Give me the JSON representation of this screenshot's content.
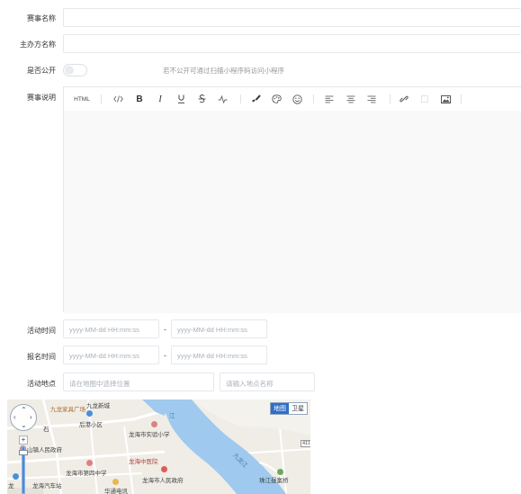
{
  "form": {
    "event_name_label": "赛事名称",
    "organizer_label": "主办方名称",
    "public_label": "是否公开",
    "public_hint": "若不公开可通过扫描小程序码访问小程序",
    "public_on": false,
    "description_label": "赛事说明",
    "activity_time_label": "活动时间",
    "signup_time_label": "报名时间",
    "location_label": "活动地点",
    "datetime_placeholder": "yyyy-MM-dd HH:mm:ss",
    "range_separator": "-",
    "map_select_placeholder": "请在地图中选择位置",
    "place_name_placeholder": "请输入地点名称"
  },
  "toolbar": {
    "html_label": "HTML",
    "icons": [
      "code-icon",
      "bold-icon",
      "italic-icon",
      "underline-icon",
      "strikethrough-icon",
      "wave-icon",
      "brush-icon",
      "palette-icon",
      "emoji-icon",
      "align-left-icon",
      "align-center-icon",
      "align-right-icon",
      "link-icon",
      "unlink-icon",
      "image-icon"
    ]
  },
  "map": {
    "type_map": "地图",
    "type_satellite": "卫星",
    "labels": {
      "l1": "九龙家具广场",
      "l2": "九龙新城",
      "l3": "后港小区",
      "l4": "龙海市实验小学",
      "l5": "山镇人民政府",
      "l6": "龙海中医院",
      "l7": "龙海市第四中学",
      "l8": "龙海市人民政府",
      "l9": "华通电讯",
      "l10": "九龙江",
      "l11": "珠江昼案桥",
      "l12": "龙海汽车站",
      "l13": "江",
      "l14": "龙",
      "l15": "石",
      "l16": "411"
    }
  }
}
